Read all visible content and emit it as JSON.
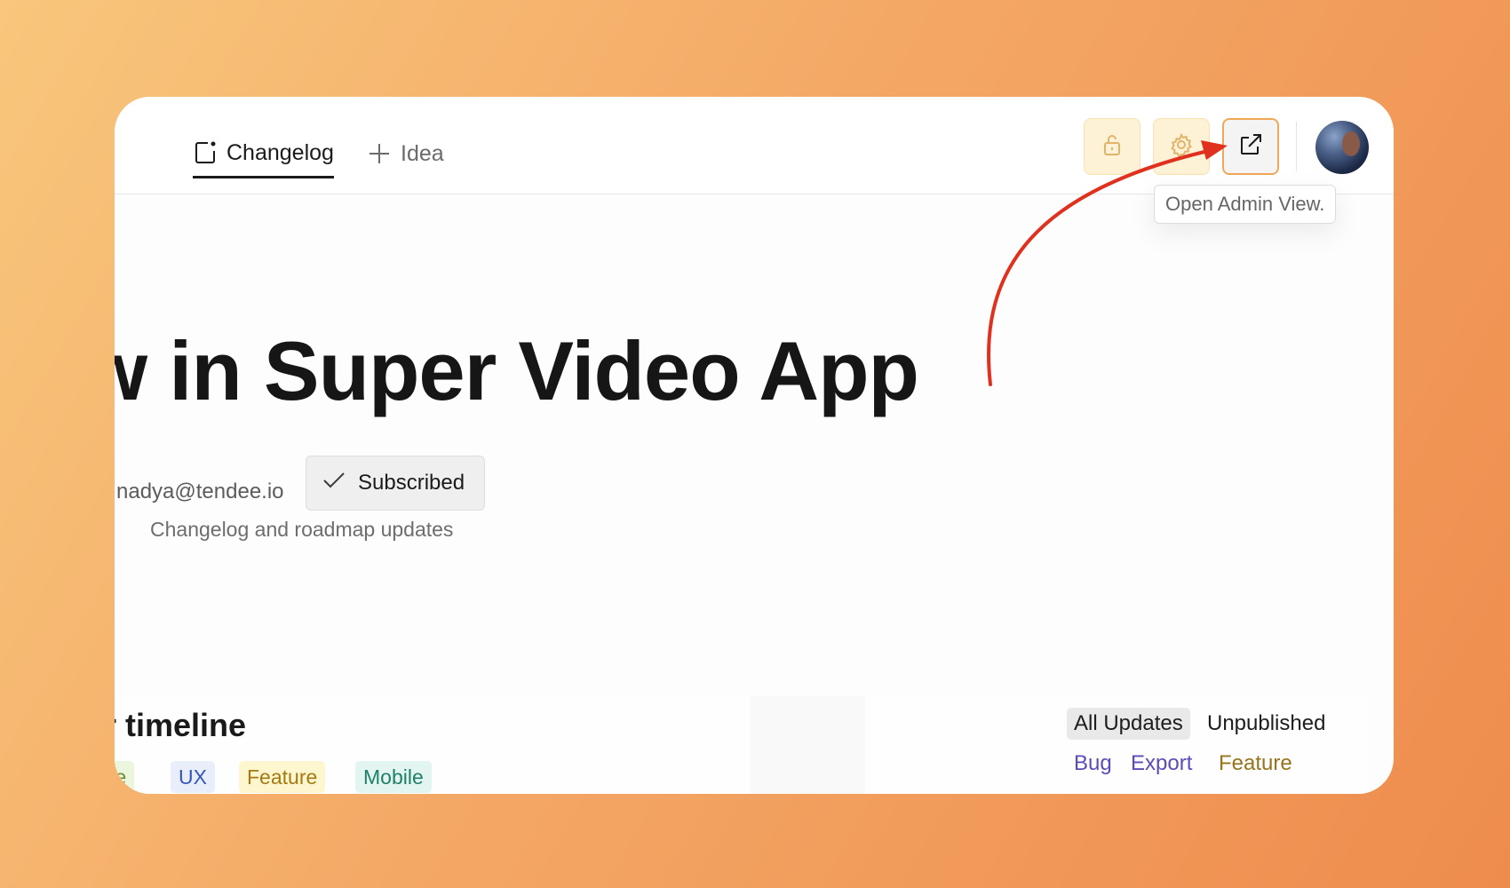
{
  "nav": {
    "changelog_label": "Changelog",
    "idea_label": "Idea"
  },
  "toolbar": {
    "tooltip": "Open Admin View."
  },
  "hero": {
    "title": "w in Super Video App",
    "email": "nadya@tendee.io",
    "subscribed_label": "Subscribed",
    "note": "Changelog and roadmap updates"
  },
  "timeline": {
    "title": "r timeline",
    "tags": [
      "ce",
      "UX",
      "Feature",
      "Mobile"
    ],
    "filters": [
      "All Updates",
      "Unpublished"
    ],
    "filter_tags": [
      "Bug",
      "Export",
      "Feature"
    ]
  },
  "colors": {
    "accent": "#f0a858",
    "arrow": "#e0301e",
    "gradient_start": "#f8c67c",
    "gradient_end": "#ee8c4d"
  },
  "icons": [
    "changelog-icon",
    "plus-icon",
    "unlock-icon",
    "gear-icon",
    "external-link-icon",
    "check-icon"
  ]
}
